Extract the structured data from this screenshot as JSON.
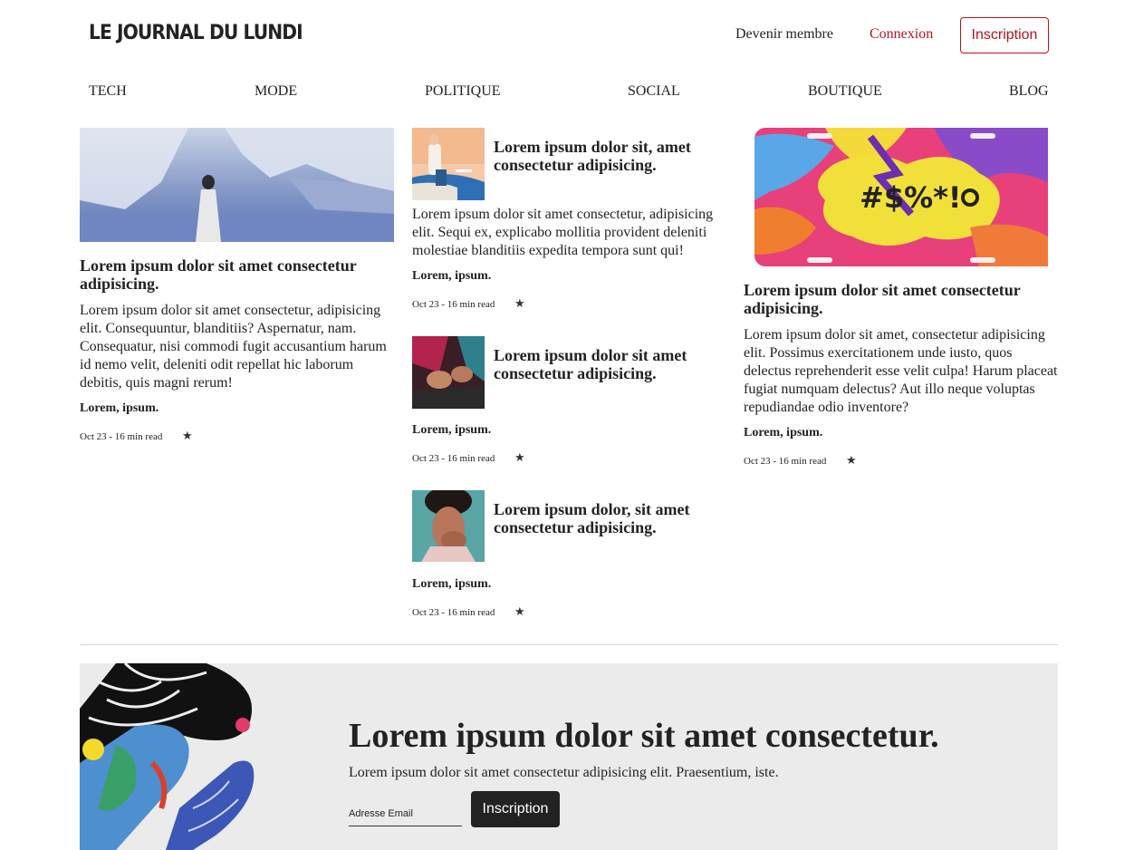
{
  "header": {
    "brand": "LE JOURNAL DU LUNDI",
    "member_link": "Devenir membre",
    "login_link": "Connexion",
    "signup_button": "Inscription"
  },
  "nav": [
    "TECH",
    "MODE",
    "POLITIQUE",
    "SOCIAL",
    "BOUTIQUE",
    "BLOG"
  ],
  "articles": {
    "left": {
      "title": "Lorem ipsum dolor sit amet consectetur adipisicing.",
      "excerpt": "Lorem ipsum dolor sit amet consectetur, adipisicing elit. Consequuntur, blanditiis? Aspernatur, nam. Consequatur, nisi commodi fugit accusantium harum id nemo velit, deleniti odit repellat hic laborum debitis, quis magni rerum!",
      "author": "Lorem, ipsum.",
      "meta": "Oct 23 - 16 min read"
    },
    "middle": [
      {
        "title": "Lorem ipsum dolor sit, amet consectetur adipisicing.",
        "excerpt": "Lorem ipsum dolor sit amet consectetur, adipisicing elit. Sequi ex, explicabo mollitia provident deleniti molestiae blanditiis expedita tempora sunt qui!",
        "author": "Lorem, ipsum.",
        "meta": "Oct 23 - 16 min read"
      },
      {
        "title": "Lorem ipsum dolor sit amet consectetur adipisicing.",
        "author": "Lorem, ipsum.",
        "meta": "Oct 23 - 16 min read"
      },
      {
        "title": "Lorem ipsum dolor, sit amet consectetur adipisicing.",
        "author": "Lorem, ipsum.",
        "meta": "Oct 23 - 16 min read"
      }
    ],
    "right": {
      "plate_text": "#$%*!",
      "title": "Lorem ipsum dolor sit amet consectetur adipisicing.",
      "excerpt": "Lorem ipsum dolor sit amet, consectetur adipisicing elit. Possimus exercitationem unde iusto, quos delectus reprehenderit esse velit culpa! Harum placeat fugiat numquam delectus? Aut illo neque voluptas repudiandae odio inventore?",
      "author": "Lorem, ipsum.",
      "meta": "Oct 23 - 16 min read"
    }
  },
  "newsletter": {
    "title": "Lorem ipsum dolor sit amet consectetur.",
    "subtitle": "Lorem ipsum dolor sit amet consectetur adipisicing elit. Praesentium, iste.",
    "email_placeholder": "Adresse Email",
    "button": "Inscription"
  },
  "icons": {
    "bookmark": "star-icon"
  },
  "colors": {
    "accent": "#b3141d",
    "dark_button": "#222222",
    "newsletter_bg": "#ebebeb"
  }
}
